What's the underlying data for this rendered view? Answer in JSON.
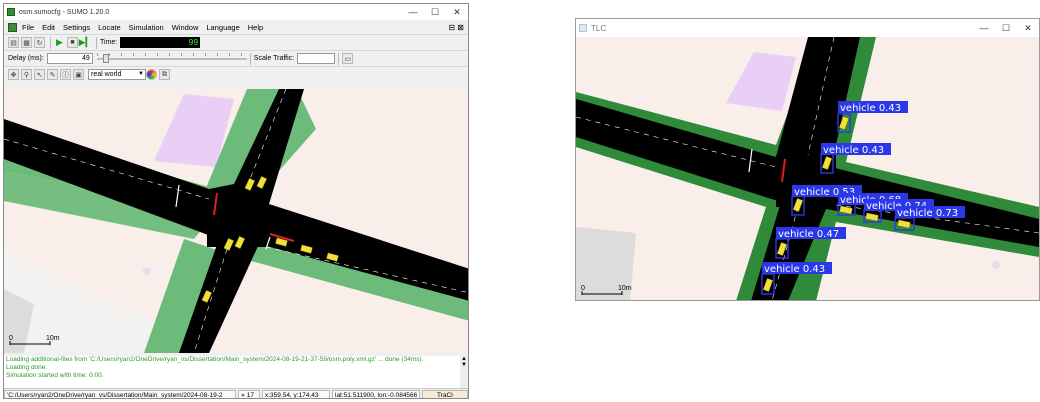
{
  "sumo": {
    "title": "osm.sumocfg - SUMO 1.20.0",
    "window_controls": {
      "minimize": "—",
      "maximize": "☐",
      "close": "✕"
    },
    "menu": [
      "File",
      "Edit",
      "Settings",
      "Locate",
      "Simulation",
      "Window",
      "Language",
      "Help"
    ],
    "toolbar": {
      "time_label": "Time:",
      "time_value": "99",
      "delay_label": "Delay (ms):",
      "delay_value": "49",
      "scale_traffic_label": "Scale Traffic:",
      "scale_traffic_value": "",
      "scheme_value": "real world"
    },
    "scale_bar": {
      "zero": "0",
      "label": "10m"
    },
    "console_lines": [
      "Loading additional-files from 'C:/Users/ryan2/OneDrive/ryan_vs/Dissertation/Main_system/2024-08-19-21-37-59/osm.poly.xml.gz' ... done (34ms).",
      "Loading done.",
      "Simulation started with time: 0.00."
    ],
    "status": {
      "path": "'C:/Users/ryan2/OneDrive/ryan_vs/Dissertation/Main_system/2024-08-19-2",
      "vehicle_count": "17",
      "coords": "x:359.54, y:174.43",
      "latlon": "lat:51.511900, lon:-0.084566",
      "mode": "TraCI"
    }
  },
  "tlc": {
    "title": "TLC",
    "window_controls": {
      "minimize": "—",
      "maximize": "☐",
      "close": "✕"
    },
    "scale_bar": {
      "zero": "0",
      "label": "10m"
    },
    "detections": [
      {
        "label": "vehicle",
        "confidence": "0.43"
      },
      {
        "label": "vehicle",
        "confidence": "0.43"
      },
      {
        "label": "vehicle",
        "confidence": "0.53"
      },
      {
        "label": "vehicle",
        "confidence": "0.68"
      },
      {
        "label": "vehicle",
        "confidence": "0.74"
      },
      {
        "label": "vehicle",
        "confidence": "0.73"
      },
      {
        "label": "vehicle",
        "confidence": "0.47"
      },
      {
        "label": "vehicle",
        "confidence": "0.43"
      }
    ]
  },
  "colors": {
    "road": "#000000",
    "sidewalk": "#6dbb7a",
    "sidewalk_dark": "#2f8b3a",
    "background": "#f9eeea",
    "building_purple": "#e9cff5",
    "vehicle": "#f2df3a",
    "detection": "#2a38e8",
    "signal_red": "#e02020"
  }
}
